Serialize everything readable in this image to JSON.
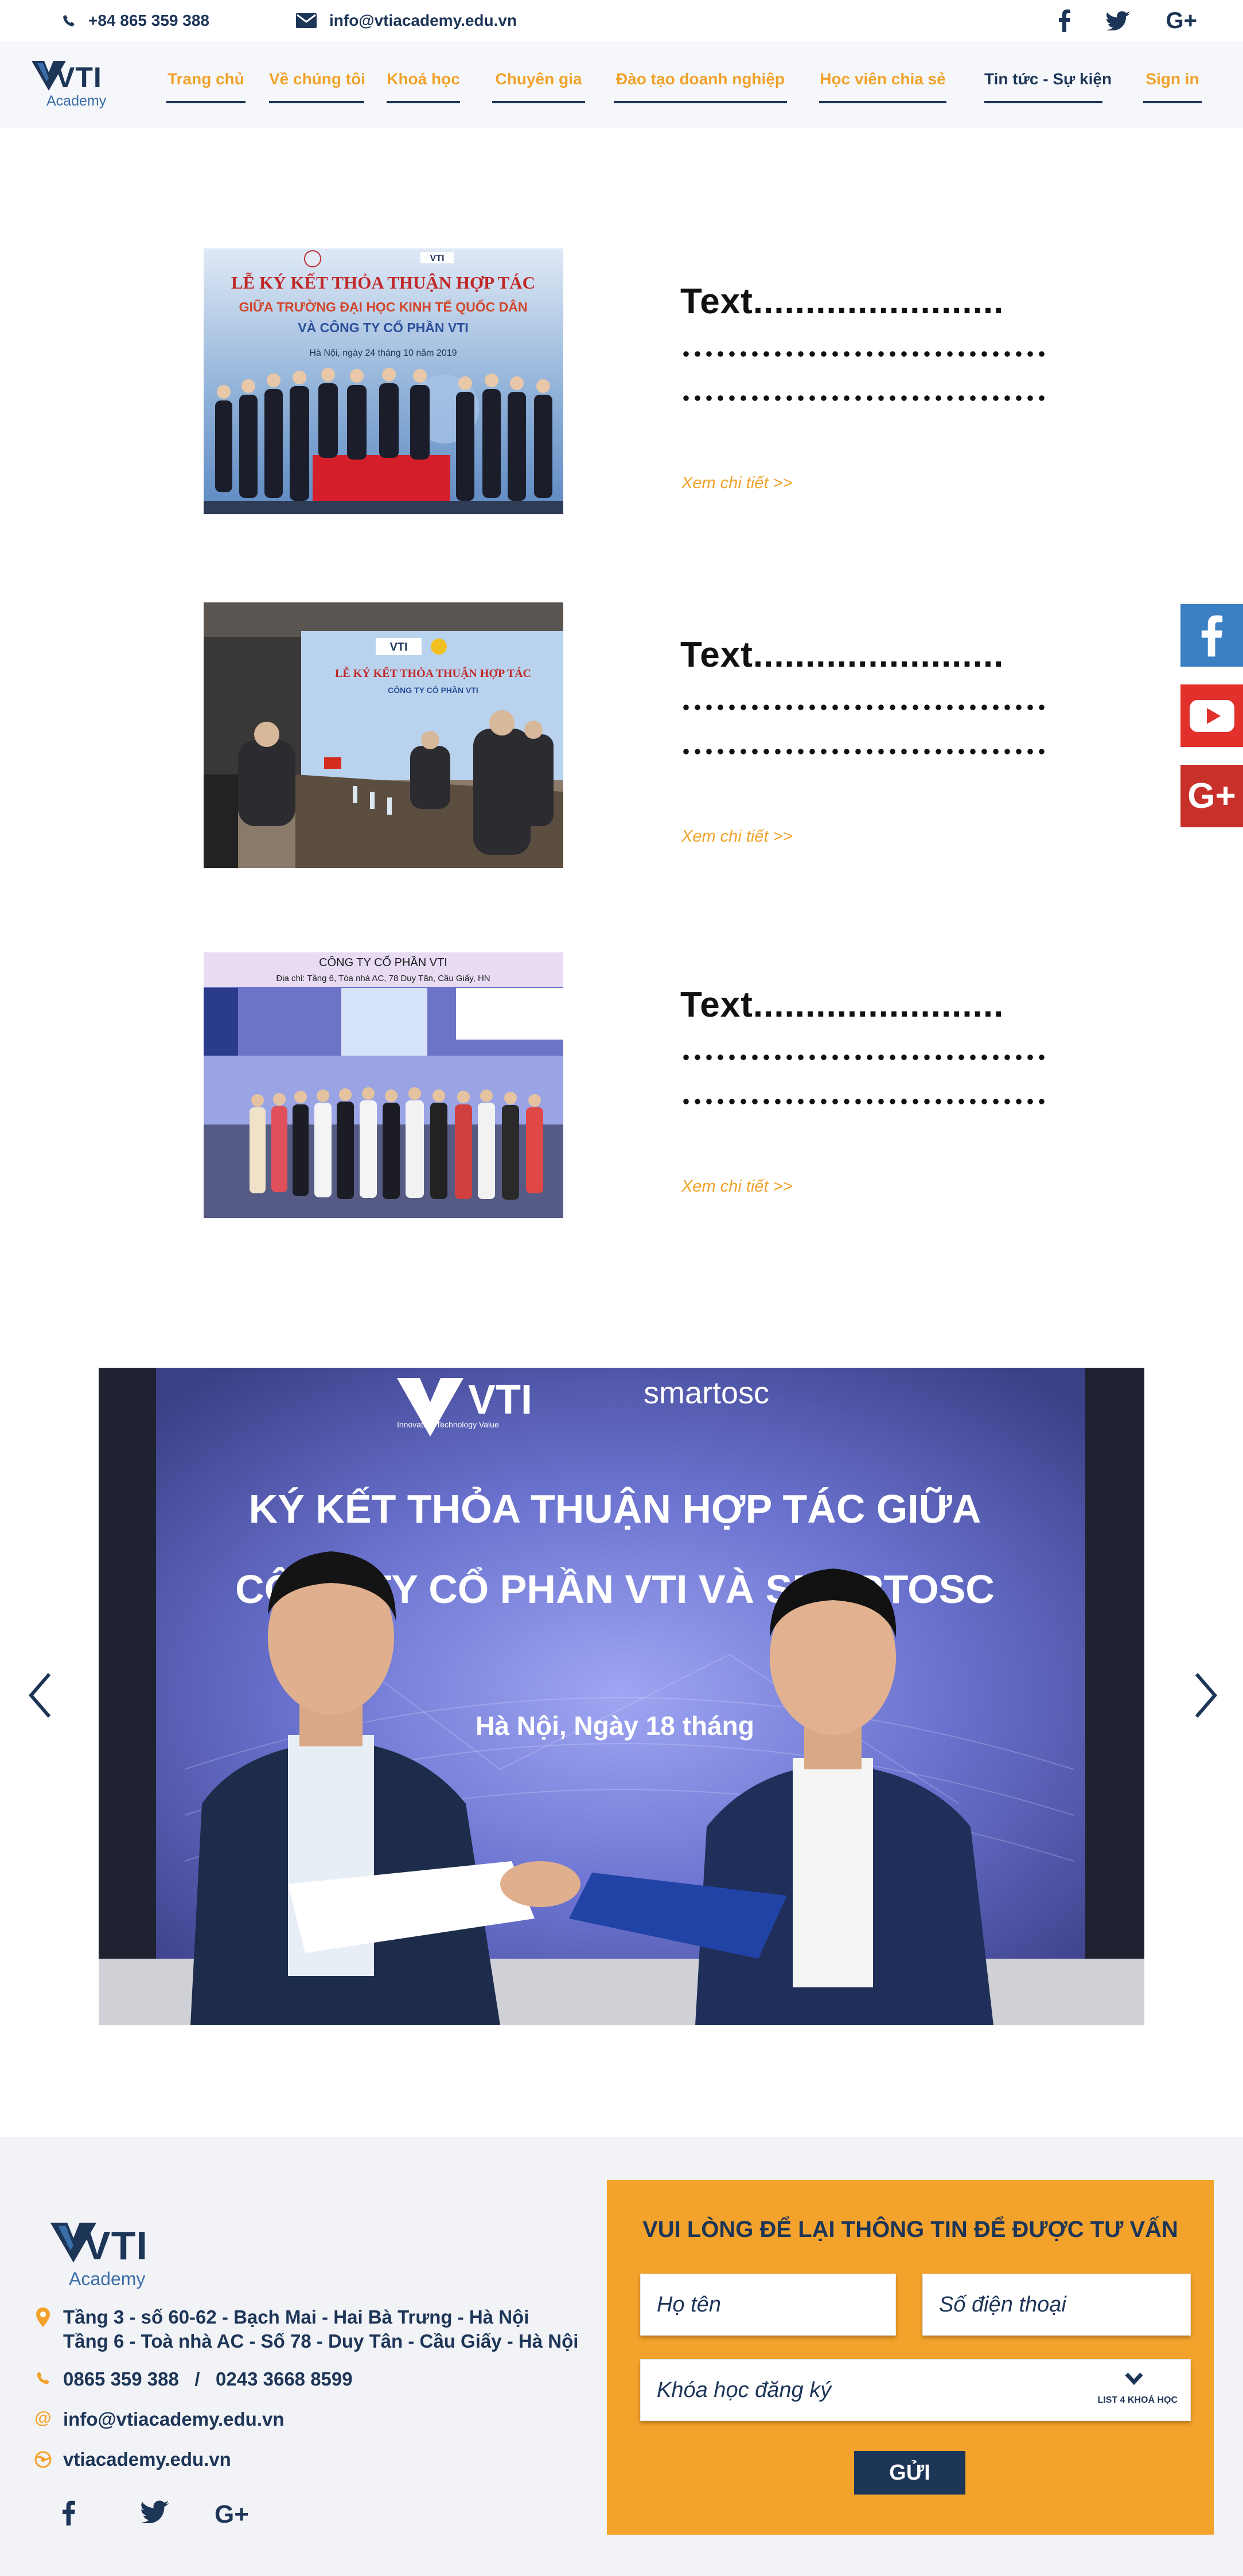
{
  "topbar": {
    "phone": "+84 865 359 388",
    "email": "info@vtiacademy.edu.vn",
    "social": [
      "facebook",
      "twitter",
      "google-plus"
    ]
  },
  "brand": {
    "name": "VTI",
    "sub": "Academy"
  },
  "nav": {
    "items": [
      {
        "label": "Trang chủ"
      },
      {
        "label": "Về chúng tôi"
      },
      {
        "label": "Khoá học"
      },
      {
        "label": "Chuyên gia"
      },
      {
        "label": "Đào tạo doanh nghiệp"
      },
      {
        "label": "Học viên chia sẻ"
      },
      {
        "label": "Tin tức - Sự kiện"
      },
      {
        "label": "Sign in"
      }
    ],
    "active": "Tin tức - Sự kiện"
  },
  "news": [
    {
      "title": "Text........................",
      "more": "Xem chi tiết >>",
      "image": {
        "heading": "LỄ KÝ KẾT THỎA THUẬN HỢP TÁC",
        "line2": "GIỮA TRƯỜNG ĐẠI HỌC KINH TẾ QUỐC DÂN",
        "line3": "VÀ CÔNG TY CỔ PHẦN VTI",
        "line4": "Hà Nội, ngày 24 tháng 10 năm 2019"
      }
    },
    {
      "title": "Text........................",
      "more": "Xem chi tiết >>",
      "image": {
        "heading": "LỄ KÝ KẾT THỎA THUẬN HỢP TÁC",
        "line2": "CÔNG TY CỔ PHẦN VTI"
      }
    },
    {
      "title": "Text........................",
      "more": "Xem chi tiết >>",
      "image": {
        "heading": "CÔNG TY CỔ PHẦN VTI",
        "line2": "Địa chỉ: Tầng 6, Tòa nhà AC, 78 Duy Tân, Cầu Giấy, HN"
      }
    }
  ],
  "side_social": [
    "facebook",
    "youtube",
    "google-plus"
  ],
  "slider": {
    "logo_left": "VTI",
    "logo_left_sub": "Innovation Technology Value",
    "logo_right": "smartosc",
    "line1": "KÝ KẾT THỎA THUẬN HỢP TÁC GIỮA",
    "line2": "CÔNG TY CỔ PHẦN VTI VÀ SMARTOSC",
    "line3": "Hà Nội, Ngày 18 tháng"
  },
  "footer": {
    "address1": "Tầng 3 - số 60-62 - Bạch Mai -  Hai Bà Trưng - Hà Nội",
    "address2": "Tầng 6 - Toà nhà AC - Số 78 - Duy Tân - Cầu Giấy - Hà Nội",
    "phones": "0865 359 388   /   0243 3668 8599",
    "email": "info@vtiacademy.edu.vn",
    "website": "vtiacademy.edu.vn"
  },
  "form": {
    "title": "VUI LÒNG ĐỂ LẠI THÔNG TIN ĐỂ ĐƯỢC TƯ VẤN",
    "name_placeholder": "Họ tên",
    "phone_placeholder": "Số điện thoại",
    "course_placeholder": "Khóa học đăng ký",
    "course_hint": "LIST 4 KHOÁ HỌC",
    "submit": "GỬI"
  },
  "colors": {
    "navy": "#1d3557",
    "orange": "#f3a22b",
    "facebook": "#3b7fc4",
    "youtube": "#e2302b",
    "googleplus": "#c8302a"
  }
}
